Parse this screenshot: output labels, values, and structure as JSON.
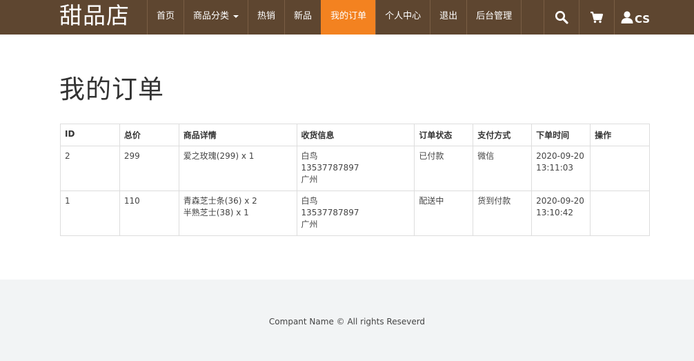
{
  "navbar": {
    "brand": "甜品店",
    "items": [
      {
        "label": "首页"
      },
      {
        "label": "商品分类"
      },
      {
        "label": "热销"
      },
      {
        "label": "新品"
      },
      {
        "label": "我的订单"
      },
      {
        "label": "个人中心"
      },
      {
        "label": "退出"
      },
      {
        "label": "后台管理"
      }
    ],
    "user": "CS",
    "accent": "#f38220",
    "background": "#5e4630"
  },
  "page": {
    "title": "我的订单"
  },
  "table": {
    "headers": [
      "ID",
      "总价",
      "商品详情",
      "收货信息",
      "订单状态",
      "支付方式",
      "下单时间",
      "操作"
    ],
    "rows": [
      {
        "id": "2",
        "total": "299",
        "items": [
          "爱之玫瑰(299) x 1"
        ],
        "ship": {
          "name": "白鸟",
          "phone": "13537787897",
          "address": "广州"
        },
        "status": "已付款",
        "payment": "微信",
        "date": "2020-09-20",
        "time": "13:11:03",
        "action": ""
      },
      {
        "id": "1",
        "total": "110",
        "items": [
          "青森芝士条(36) x 2",
          "半熟芝士(38) x 1"
        ],
        "ship": {
          "name": "白鸟",
          "phone": "13537787897",
          "address": "广州"
        },
        "status": "配送中",
        "payment": "货到付款",
        "date": "2020-09-20",
        "time": "13:10:42",
        "action": ""
      }
    ]
  },
  "footer": {
    "text": "Compant Name © All rights Reseverd"
  },
  "icons": {
    "search": "search-icon",
    "cart": "cart-icon",
    "user": "user-icon"
  }
}
